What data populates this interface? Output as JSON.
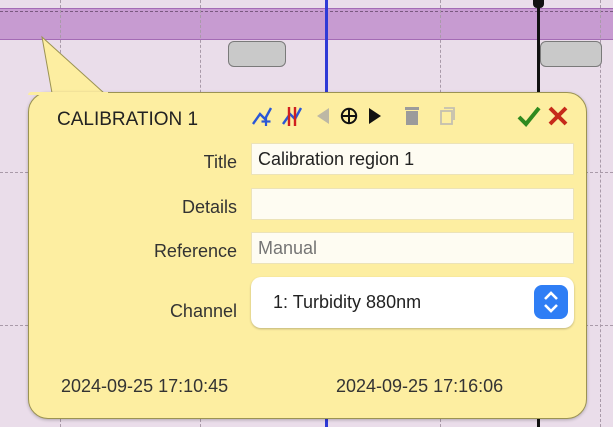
{
  "popup": {
    "title": "CALIBRATION 1",
    "fields": {
      "title_label": "Title",
      "title_value": "Calibration region 1",
      "details_label": "Details",
      "details_value": "",
      "reference_label": "Reference",
      "reference_placeholder": "Manual",
      "channel_label": "Channel",
      "channel_value": "1: Turbidity 880nm"
    },
    "start_time": "2024-09-25 17:10:45",
    "end_time": "2024-09-25 17:16:06"
  },
  "icons": [
    "add-line-icon",
    "remove-line-icon",
    "previous-icon",
    "crosshair-icon",
    "next-icon",
    "trash-icon",
    "copy-icon",
    "check-icon",
    "close-icon"
  ],
  "colors": {
    "popup_background": "#fdeea1",
    "region_band": "#c79bd1",
    "plot_background": "#eaddea",
    "blue_cursor": "#2f3ad6",
    "confirm_green": "#2f8a1f",
    "cancel_red": "#c62a1a",
    "select_button_blue": "#2f7ef5"
  }
}
